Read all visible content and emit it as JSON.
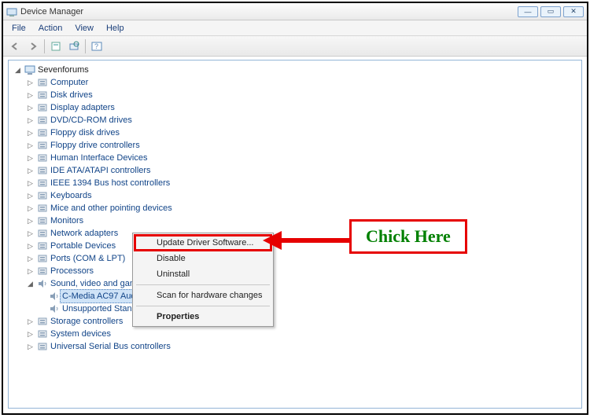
{
  "window": {
    "title": "Device Manager"
  },
  "menubar": {
    "file": "File",
    "action": "Action",
    "view": "View",
    "help": "Help"
  },
  "tree": {
    "root": "Sevenforums",
    "items": [
      "Computer",
      "Disk drives",
      "Display adapters",
      "DVD/CD-ROM drives",
      "Floppy disk drives",
      "Floppy drive controllers",
      "Human Interface Devices",
      "IDE ATA/ATAPI controllers",
      "IEEE 1394 Bus host controllers",
      "Keyboards",
      "Mice and other pointing devices",
      "Monitors",
      "Network adapters",
      "Portable Devices",
      "Ports (COM & LPT)",
      "Processors"
    ],
    "sound_category": "Sound, video and game controllers",
    "sound_children": {
      "selected": "C-Media AC97 Audio Device",
      "other": "Unsupported Standard Game Port"
    },
    "after": [
      "Storage controllers",
      "System devices",
      "Universal Serial Bus controllers"
    ]
  },
  "context_menu": {
    "update": "Update Driver Software...",
    "disable": "Disable",
    "uninstall": "Uninstall",
    "scan": "Scan for hardware changes",
    "properties": "Properties"
  },
  "callout": {
    "text": "Chick Here"
  }
}
